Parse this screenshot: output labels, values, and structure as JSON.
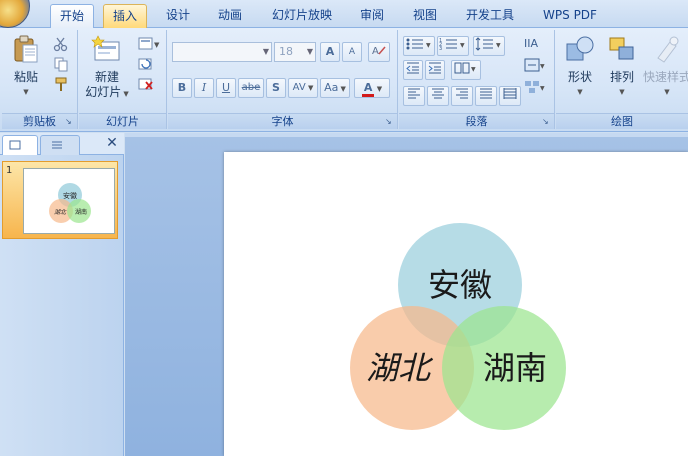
{
  "tabs": [
    {
      "label": "开始"
    },
    {
      "label": "插入"
    },
    {
      "label": "设计"
    },
    {
      "label": "动画"
    },
    {
      "label": "幻灯片放映"
    },
    {
      "label": "审阅"
    },
    {
      "label": "视图"
    },
    {
      "label": "开发工具"
    },
    {
      "label": "WPS PDF"
    }
  ],
  "active_tab": "开始",
  "hovered_tab": "插入",
  "ribbon": {
    "clipboard": {
      "paste_label": "粘贴",
      "group_label": "剪贴板"
    },
    "slides": {
      "new_slide_line1": "新建",
      "new_slide_line2": "幻灯片",
      "group_label": "幻灯片"
    },
    "font": {
      "font_name": "",
      "font_size": "18",
      "bold": "B",
      "italic": "I",
      "underline": "U",
      "strike": "abe",
      "shadow": "S",
      "spacing": "AV",
      "case": "Aa",
      "color": "A",
      "grow": "A",
      "shrink": "A",
      "group_label": "字体"
    },
    "paragraph": {
      "group_label": "段落"
    },
    "drawing": {
      "shapes_label": "形状",
      "arrange_label": "排列",
      "quick_styles_label": "快速样式",
      "group_label": "绘图"
    }
  },
  "slide_panel": {
    "slide_number": "1",
    "thumbnail_labels": {
      "top": "安徽",
      "left": "湖北",
      "right": "湖南"
    }
  },
  "slide": {
    "circles": [
      {
        "label": "安徽",
        "color": "#8fc9d9",
        "italic": false
      },
      {
        "label": "湖北",
        "color": "#f6b98b",
        "italic": true
      },
      {
        "label": "湖南",
        "color": "#9be58f",
        "italic": false
      }
    ]
  },
  "colors": {
    "tab_bar": "#dbe8f8",
    "ribbon": "#d6e5f7",
    "work_area": "#9cbbe4",
    "slide_selected": "#f7b54d"
  }
}
